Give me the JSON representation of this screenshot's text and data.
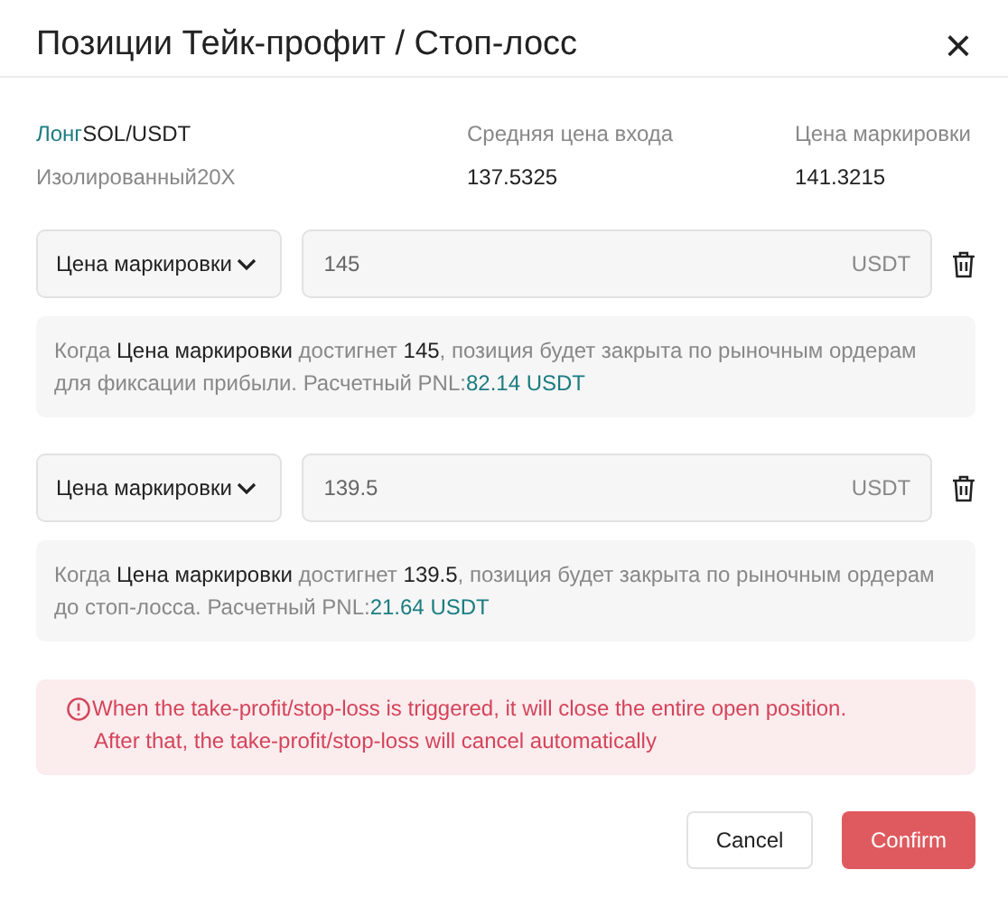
{
  "dialog": {
    "title": "Позиции Тейк-профит / Стоп-лосс",
    "close": "×"
  },
  "position": {
    "side": "Лонг",
    "pair": "SOL/USDT",
    "margin": "Изолированный20X",
    "columns": [
      {
        "label": "Средняя цена входа",
        "value": "137.5325"
      },
      {
        "label": "Цена маркировки",
        "value": "141.3215"
      }
    ]
  },
  "orders": [
    {
      "trigger": "Цена маркировки",
      "price": "145",
      "unit": "USDT",
      "note": "Когда **Цена маркировки** достигнет **145**, позиция будет закрыта по рыночным ордерам для фиксации прибыли. Расчетный PNL:",
      "pnl": "82.14 USDT"
    },
    {
      "trigger": "Цена маркировки",
      "price": "139.5",
      "unit": "USDT",
      "note": "Когда **Цена маркировки** достигнет **139.5**, позиция будет закрыта по рыночным ордерам до стоп-лосса. Расчетный PNL:",
      "pnl": "21.64 USDT"
    }
  ],
  "warning": {
    "lines": [
      "When the take-profit/stop-loss is triggered, it will close the entire open position.",
      "After that, the take-profit/stop-loss will cancel automatically"
    ]
  },
  "buttons": [
    {
      "label": "Cancel",
      "kind": "secondary"
    },
    {
      "label": "Confirm",
      "kind": "primary"
    }
  ]
}
